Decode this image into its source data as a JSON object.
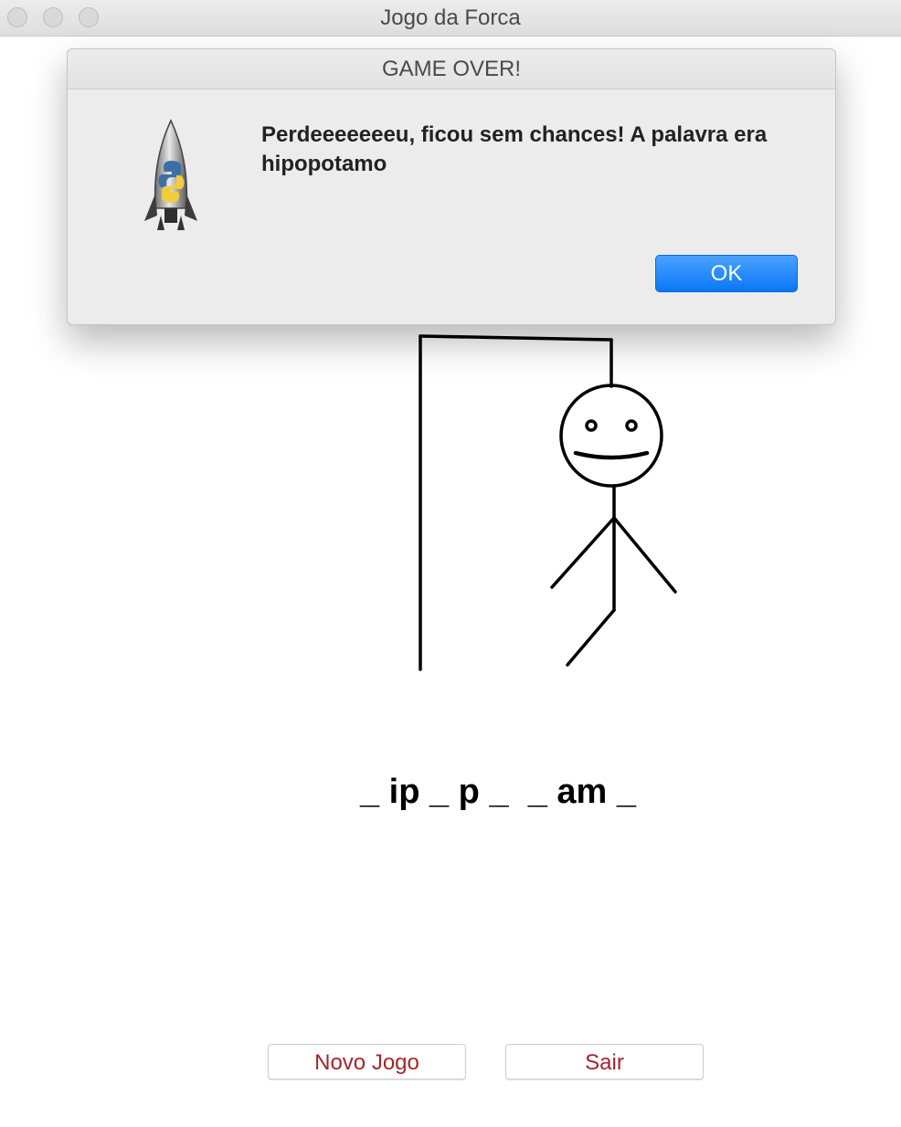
{
  "window": {
    "title": "Jogo da Forca"
  },
  "dialog": {
    "title": "GAME OVER!",
    "message": "Perdeeeeeeeu, ficou sem chances! A palavra era hipopotamo",
    "ok_label": "OK",
    "icon": "python-launcher-rocket-icon"
  },
  "game": {
    "word_display": "_ ip _ p _  _ am _"
  },
  "buttons": {
    "new_game_label": "Novo Jogo",
    "quit_label": "Sair"
  },
  "colors": {
    "button_text": "#a3262c",
    "ok_button": "#0a77f7"
  }
}
